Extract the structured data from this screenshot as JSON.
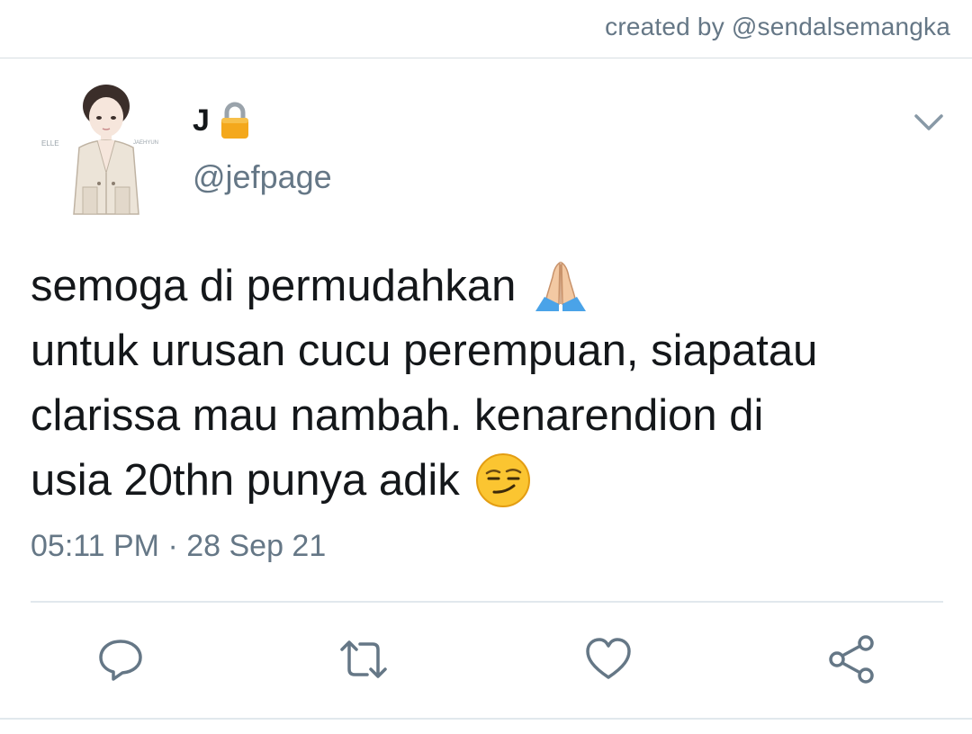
{
  "credit": "created by @sendalsemangka",
  "tweet": {
    "display_name": "J",
    "handle": "@jefpage",
    "avatar_labels": {
      "left": "ELLE",
      "right": "JAEHYUN"
    },
    "text_lines": [
      "semoga di permudahkan",
      "untuk urusan cucu perempuan, siapatau",
      "clarissa mau nambah. kenarendion di",
      "usia 20thn punya adik"
    ],
    "timestamp": "05:11 PM · 28 Sep 21"
  },
  "icons": {
    "verified_lock": "lock-icon",
    "menu": "chevron-down-icon",
    "line1_emoji": "folded-hands-emoji",
    "line4_emoji": "smirking-face-emoji",
    "actions": [
      "reply-icon",
      "retweet-icon",
      "like-icon",
      "share-icon"
    ]
  },
  "colors": {
    "text_primary": "#14171a",
    "text_secondary": "#657786",
    "divider": "#e1e8ed",
    "icon_gray": "#657786",
    "lock_gold": "#f4a81c"
  }
}
